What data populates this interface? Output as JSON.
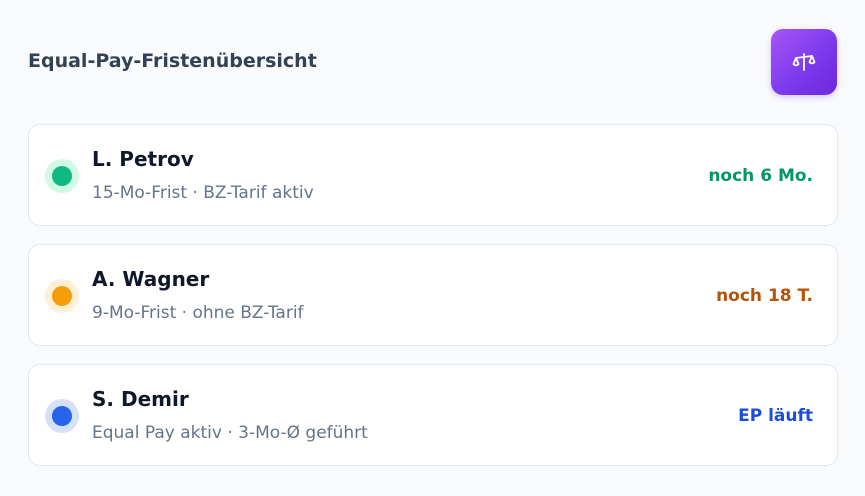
{
  "header": {
    "title": "Equal-Pay-Fristenübersicht",
    "logo_icon": "scale-icon"
  },
  "items": [
    {
      "name": "L. Petrov",
      "detail": "15-Mo-Frist · BZ-Tarif aktiv",
      "status": "noch 6 Mo.",
      "dot_color": "#10b981",
      "ring_color": "#d1fae5",
      "status_color": "#059669"
    },
    {
      "name": "A. Wagner",
      "detail": "9-Mo-Frist · ohne BZ-Tarif",
      "status": "noch 18 T.",
      "dot_color": "#f59e0b",
      "ring_color": "#fdf0d5",
      "status_color": "#b45309"
    },
    {
      "name": "S. Demir",
      "detail": "Equal Pay aktiv · 3-Mo-Ø geführt",
      "status": "EP läuft",
      "dot_color": "#2563eb",
      "ring_color": "#d5e1f7",
      "status_color": "#1d4ed8"
    }
  ]
}
